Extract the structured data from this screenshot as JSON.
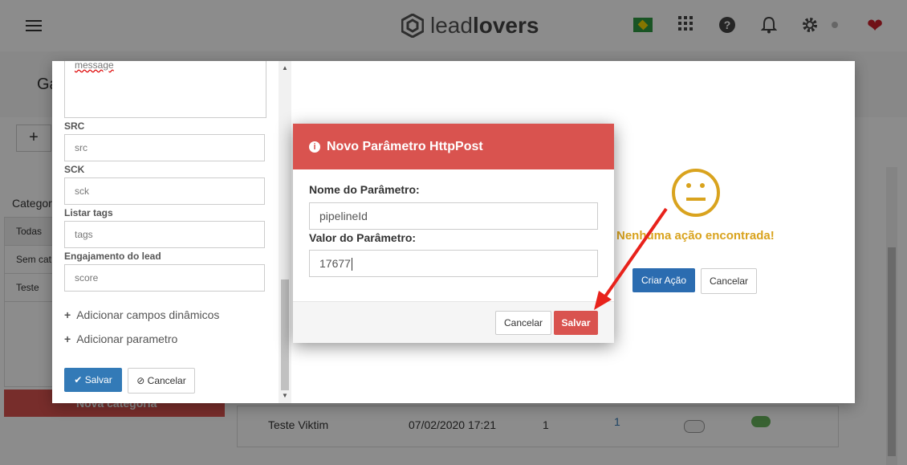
{
  "brand": {
    "logo_light": "lead",
    "logo_bold": "lovers"
  },
  "page": {
    "title_partial": "Ga",
    "add_symbol": "+",
    "categories_title": "Categor",
    "categories": [
      {
        "label": "Todas",
        "active": true
      },
      {
        "label": "Sem cat",
        "active": false
      },
      {
        "label": "Teste",
        "active": false
      }
    ],
    "new_category_label": "Nova categoria",
    "row": {
      "name": "Teste Viktim",
      "date": "07/02/2020 17:21",
      "count_a": "1",
      "count_b": "1"
    }
  },
  "action_dialog": {
    "textarea_value": "message",
    "fields": [
      {
        "label": "SRC",
        "value": "src"
      },
      {
        "label": "SCK",
        "value": "sck"
      },
      {
        "label": "Listar tags",
        "value": "tags"
      },
      {
        "label": "Engajamento do lead",
        "value": "score"
      }
    ],
    "add_dynamic_fields": "Adicionar campos dinâmicos",
    "add_parameter": "Adicionar parametro",
    "save_label": "Salvar",
    "cancel_label": "Cancelar",
    "empty_message": "Nenhuma ação encontrada!",
    "create_action_label": "Criar Ação",
    "cancel_right_label": "Cancelar"
  },
  "modal": {
    "title": "Novo Parâmetro HttpPost",
    "name_label": "Nome do Parâmetro:",
    "name_value": "pipelineId",
    "value_label": "Valor do Parâmetro:",
    "value_value": "17677",
    "cancel_label": "Cancelar",
    "save_label": "Salvar"
  },
  "colors": {
    "danger": "#d9534f",
    "primary": "#337ab7",
    "warning": "#d9a31e",
    "arrow": "#e8221b"
  }
}
